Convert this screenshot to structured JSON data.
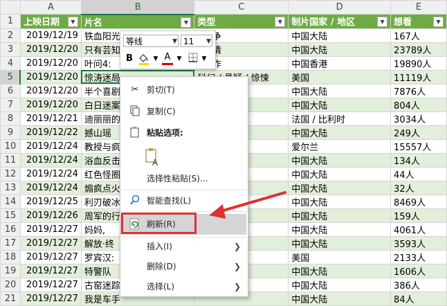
{
  "columns": [
    "A",
    "B",
    "C",
    "D",
    "E"
  ],
  "active_column": "B",
  "active_row": "5",
  "header_row": {
    "num": "1",
    "cells": [
      "上映日期",
      "片名",
      "类型",
      "制片国家 / 地区",
      "想看"
    ]
  },
  "rows": [
    {
      "num": "2",
      "cells": [
        "2019/12/19",
        "铁血阳光",
        "/ 战争",
        "中国大陆",
        "167人"
      ]
    },
    {
      "num": "3",
      "cells": [
        "2019/12/20",
        "只有芸知",
        "/ 爱情",
        "中国大陆",
        "23789人"
      ]
    },
    {
      "num": "4",
      "cells": [
        "2019/12/20",
        "叶问4:",
        "/ 动作",
        "中国香港",
        "19890人"
      ]
    },
    {
      "num": "5",
      "cells": [
        "2019/12/20",
        "惊涛迷局",
        "科幻 / 悬疑 / 惊悚",
        "美国",
        "11119人"
      ]
    },
    {
      "num": "6",
      "cells": [
        "2019/12/20",
        "半个喜剧",
        "",
        "中国大陆",
        "7876人"
      ]
    },
    {
      "num": "7",
      "cells": [
        "2019/12/20",
        "白日迷案",
        "",
        "中国大陆",
        "804人"
      ]
    },
    {
      "num": "8",
      "cells": [
        "2019/12/21",
        "迪丽丽的",
        "",
        "法国 / 比利时",
        "3034人"
      ]
    },
    {
      "num": "9",
      "cells": [
        "2019/12/22",
        "撼山瑶",
        "",
        "中国大陆",
        "249人"
      ]
    },
    {
      "num": "10",
      "cells": [
        "2019/12/24",
        "教授与疯",
        "",
        "爱尔兰",
        "15557人"
      ]
    },
    {
      "num": "11",
      "cells": [
        "2019/12/24",
        "浴血反击",
        "",
        "中国大陆",
        "134人"
      ]
    },
    {
      "num": "12",
      "cells": [
        "2019/12/24",
        "红色怪圈",
        "",
        "中国大陆",
        "44人"
      ]
    },
    {
      "num": "13",
      "cells": [
        "2019/12/24",
        "煽疯点火",
        "/ 爱情",
        "中国大陆",
        "32人"
      ]
    },
    {
      "num": "14",
      "cells": [
        "2019/12/25",
        "利刃破冰",
        "",
        "中国大陆",
        "8469人"
      ]
    },
    {
      "num": "15",
      "cells": [
        "2019/12/26",
        "周军的行",
        "",
        "中国大陆",
        "159人"
      ]
    },
    {
      "num": "16",
      "cells": [
        "2019/12/27",
        "妈妈,",
        "",
        "中国大陆",
        "4061人"
      ]
    },
    {
      "num": "17",
      "cells": [
        "2019/12/27",
        "解放·终",
        "/ 战争",
        "中国大陆",
        "3593人"
      ]
    },
    {
      "num": "18",
      "cells": [
        "2019/12/27",
        "罗宾汉:",
        "",
        "美国",
        "2133人"
      ]
    },
    {
      "num": "19",
      "cells": [
        "2019/12/27",
        "特警队",
        "",
        "中国大陆",
        "1606人"
      ]
    },
    {
      "num": "20",
      "cells": [
        "2019/12/27",
        "古窑迷踪",
        "",
        "中国大陆",
        "386人"
      ]
    },
    {
      "num": "21",
      "cells": [
        "2019/12/27",
        "我是车手",
        "",
        "中国大陆",
        "84人"
      ]
    }
  ],
  "mini_toolbar": {
    "font_name": "等线",
    "font_size": "11",
    "bold": "B",
    "font_color": "A"
  },
  "context_menu": {
    "cut": "剪切(T)",
    "copy": "复制(C)",
    "paste_options": "粘贴选项:",
    "paste_special": "选择性粘贴(S)...",
    "smart_lookup": "智能查找(L)",
    "refresh": "刷新(R)",
    "insert": "插入(I)",
    "delete": "删除(D)",
    "select": "选择(L)"
  },
  "colors": {
    "header_green": "#6eac43",
    "band_green": "#e2efda",
    "excel_green": "#217346",
    "annotation_red": "#e03030"
  }
}
